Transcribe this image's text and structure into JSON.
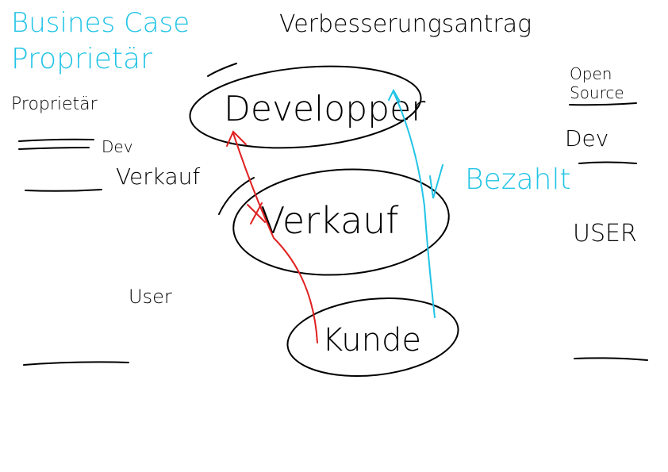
{
  "title_left": {
    "line1": "Busines Case",
    "line2": "Proprietär"
  },
  "title_center": "Verbesserungsantrag",
  "left_column": {
    "heading": "Proprietär",
    "dev": "Dev",
    "verkauf": "Verkauf",
    "user": "User"
  },
  "right_column": {
    "heading_line1": "Open",
    "heading_line2": "Source",
    "dev": "Dev",
    "user": "USER"
  },
  "nodes": {
    "developer": "Developper",
    "verkauf": "Verkauf",
    "kunde": "Kunde"
  },
  "labels": {
    "bezahlt": "Bezahlt"
  },
  "colors": {
    "ink": "#000000",
    "cyan": "#21c4e6",
    "red": "#e02020"
  }
}
